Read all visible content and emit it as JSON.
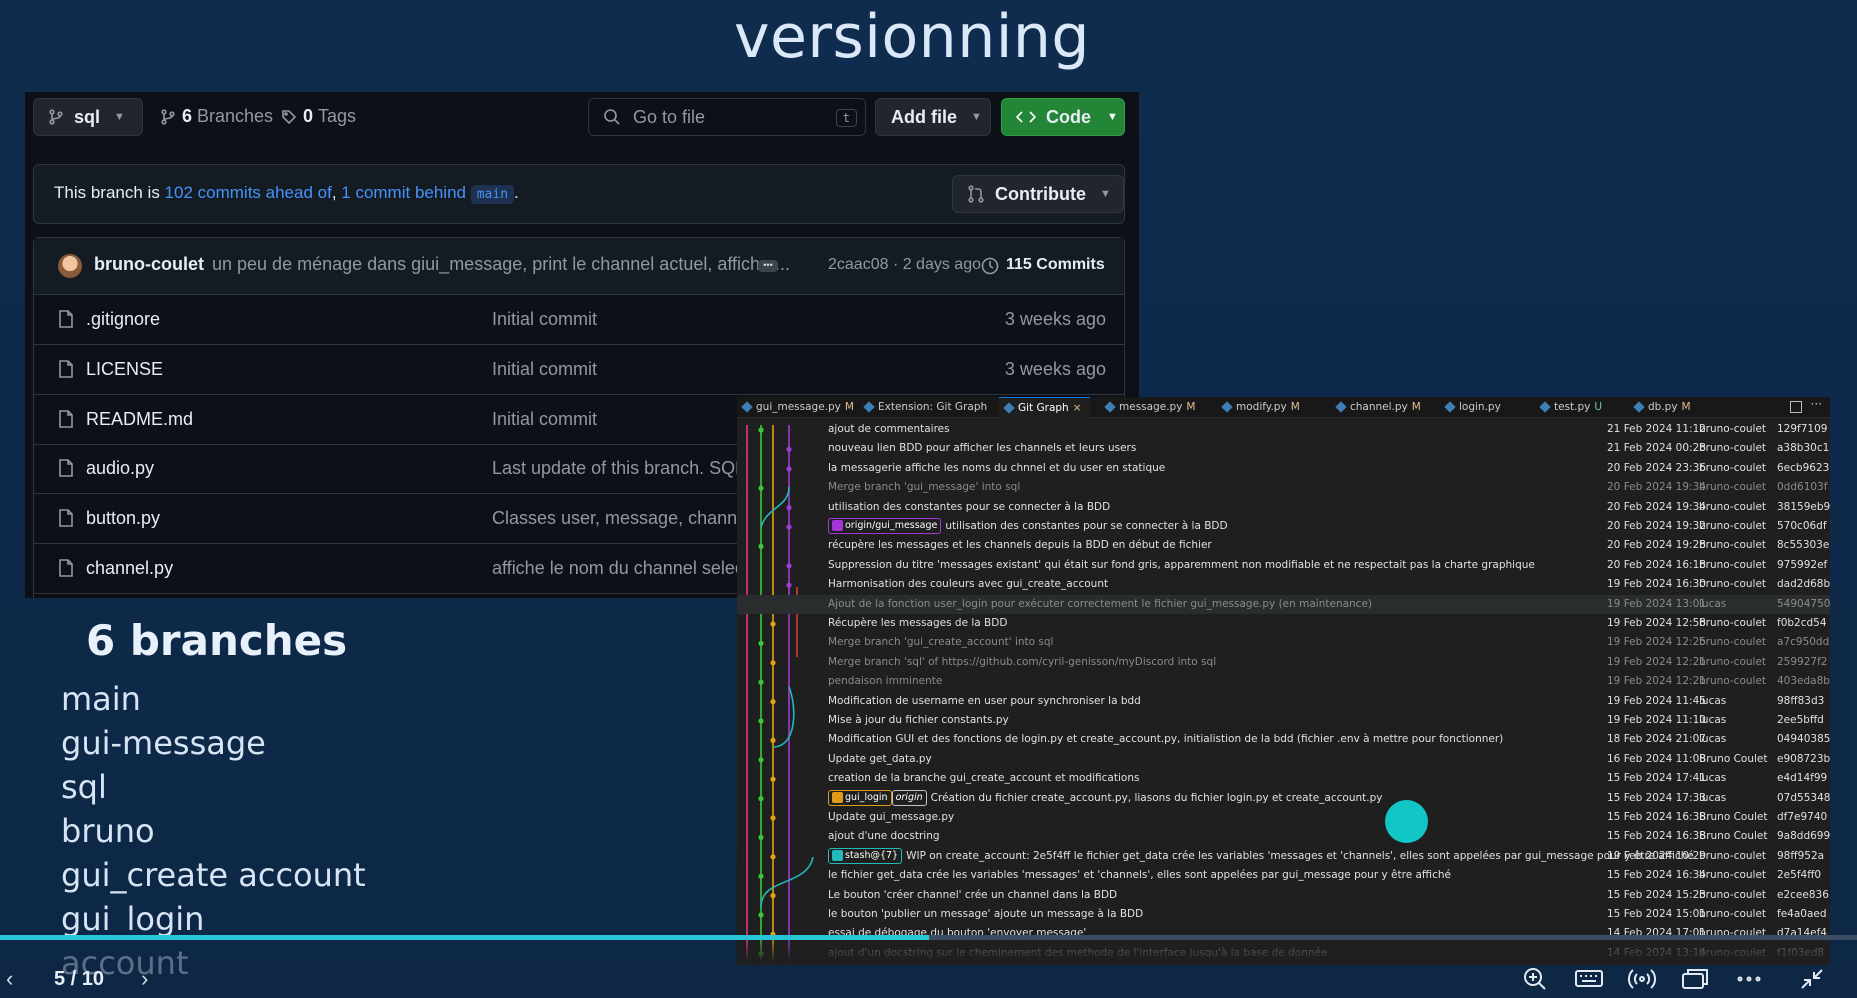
{
  "slide": {
    "title": "versionning",
    "branches_title": "6 branches",
    "branches": [
      "main",
      "gui-message",
      "sql",
      "bruno",
      "gui_create account",
      "gui_login",
      "account"
    ],
    "pager": "5 / 10",
    "progress": 0.5
  },
  "github": {
    "branch_selector": "sql",
    "branches_count": "6",
    "branches_label": "Branches",
    "tags_count": "0",
    "tags_label": "Tags",
    "search_placeholder": "Go to file",
    "search_shortcut": "t",
    "add_file_label": "Add file",
    "code_label": "Code",
    "banner": {
      "prefix": "This branch is ",
      "ahead_link": "102 commits ahead of",
      "separator": ", ",
      "behind_link": "1 commit behind",
      "space": " ",
      "base_branch": "main",
      "suffix": "."
    },
    "contribute_label": "Contribute",
    "last_commit": {
      "author": "bruno-coulet",
      "message": "un peu de ménage dans giui_message, print le channel actuel, affiche ...",
      "hash_time": "2caac08 · 2 days ago",
      "commits_count": "115 Commits"
    },
    "files": [
      {
        "name": ".gitignore",
        "message": "Initial commit",
        "date": "3 weeks ago"
      },
      {
        "name": "LICENSE",
        "message": "Initial commit",
        "date": "3 weeks ago"
      },
      {
        "name": "README.md",
        "message": "Initial commit",
        "date": ""
      },
      {
        "name": "audio.py",
        "message": "Last update of this branch. SQL o",
        "date": ""
      },
      {
        "name": "button.py",
        "message": "Classes user, message, channel, D",
        "date": ""
      },
      {
        "name": "channel.py",
        "message": "affiche le nom du channel selecti",
        "date": ""
      }
    ]
  },
  "vscode": {
    "tabs": [
      {
        "label": "gui_message.py",
        "status": "M",
        "icon": "python-file-icon"
      },
      {
        "label": "Extension: Git Graph",
        "status": "",
        "icon": "extension-icon"
      },
      {
        "label": "Git Graph",
        "status": "×",
        "icon": "git-graph-icon"
      },
      {
        "label": "message.py",
        "status": "M",
        "icon": "python-file-icon"
      },
      {
        "label": "modify.py",
        "status": "M",
        "icon": "python-file-icon"
      },
      {
        "label": "channel.py",
        "status": "M",
        "icon": "python-file-icon"
      },
      {
        "label": "login.py",
        "status": "",
        "icon": "python-file-icon"
      },
      {
        "label": "test.py",
        "status": "U",
        "icon": "python-file-icon"
      },
      {
        "label": "db.py",
        "status": "M",
        "icon": "python-file-icon"
      }
    ],
    "more": "···",
    "commits": [
      {
        "message": "ajout de commentaires",
        "date": "21 Feb 2024 11:12",
        "author": "bruno-coulet",
        "hash": "129f7109"
      },
      {
        "message": "nouveau lien BDD pour afficher les channels et leurs users",
        "date": "21 Feb 2024 00:28",
        "author": "bruno-coulet",
        "hash": "a38b30c1"
      },
      {
        "message": "la messagerie affiche les noms du chnnel et du user en statique",
        "date": "20 Feb 2024 23:36",
        "author": "bruno-coulet",
        "hash": "6ecb9623"
      },
      {
        "message": "Merge branch 'gui_message' into sql",
        "date": "20 Feb 2024 19:34",
        "author": "bruno-coulet",
        "hash": "0dd6103f",
        "dim": true
      },
      {
        "message": "utilisation des constantes pour se connecter à la BDD",
        "date": "20 Feb 2024 19:34",
        "author": "bruno-coulet",
        "hash": "38159eb9"
      },
      {
        "ref": "origin/gui_message",
        "message": "utilisation des constantes pour se connecter à la BDD",
        "date": "20 Feb 2024 19:32",
        "author": "bruno-coulet",
        "hash": "570c06df"
      },
      {
        "message": "récupère les messages et les channels depuis la BDD en début de fichier",
        "date": "20 Feb 2024 19:28",
        "author": "bruno-coulet",
        "hash": "8c55303e"
      },
      {
        "message": "Suppression du titre 'messages existant' qui était sur fond gris, apparemment non modifiable et ne respectait pas la charte graphique",
        "date": "20 Feb 2024 16:18",
        "author": "bruno-coulet",
        "hash": "975992ef"
      },
      {
        "message": "Harmonisation des couleurs avec gui_create_account",
        "date": "19 Feb 2024 16:30",
        "author": "bruno-coulet",
        "hash": "dad2d68b"
      },
      {
        "message": "Ajout de la fonction user_login pour exécuter correctement le fichier gui_message.py (en maintenance)",
        "date": "19 Feb 2024 13:01",
        "author": "lucas",
        "hash": "54904750",
        "dim": true,
        "hl": true
      },
      {
        "message": "Récupère les messages de la BDD",
        "date": "19 Feb 2024 12:58",
        "author": "bruno-coulet",
        "hash": "f0b2cd54"
      },
      {
        "message": "Merge branch 'gui_create_account' into sql",
        "date": "19 Feb 2024 12:25",
        "author": "bruno-coulet",
        "hash": "a7c950dd",
        "dim": true
      },
      {
        "message": "Merge branch 'sql' of https://github.com/cyril-genisson/myDiscord into sql",
        "date": "19 Feb 2024 12:21",
        "author": "bruno-coulet",
        "hash": "259927f2",
        "dim": true
      },
      {
        "message": "pendaison imminente",
        "date": "19 Feb 2024 12:21",
        "author": "bruno-coulet",
        "hash": "403eda8b",
        "dim": true
      },
      {
        "message": "Modification de username en user pour synchroniser la bdd",
        "date": "19 Feb 2024 11:45",
        "author": "lucas",
        "hash": "98ff83d3"
      },
      {
        "message": "Mise à jour du fichier constants.py",
        "date": "19 Feb 2024 11:10",
        "author": "lucas",
        "hash": "2ee5bffd"
      },
      {
        "message": "Modification GUI et des fonctions de login.py et create_account.py, initialistion de la bdd (fichier .env à mettre pour fonctionner)",
        "date": "18 Feb 2024 21:07",
        "author": "lucas",
        "hash": "04940385"
      },
      {
        "message": "Update get_data.py",
        "date": "16 Feb 2024 11:08",
        "author": "Bruno Coulet",
        "hash": "e908723b"
      },
      {
        "message": "creation de la branche gui_create_account et modifications",
        "date": "15 Feb 2024 17:41",
        "author": "lucas",
        "hash": "e4d14f99"
      },
      {
        "ref": "gui_login",
        "ref2": "origin",
        "message": "Création du fichier create_account.py, liasons du fichier login.py et create_account.py",
        "date": "15 Feb 2024 17:33",
        "author": "lucas",
        "hash": "07d55348"
      },
      {
        "message": "Update gui_message.py",
        "date": "15 Feb 2024 16:38",
        "author": "Bruno Coulet",
        "hash": "df7e9740"
      },
      {
        "message": "ajout d'une docstring",
        "date": "15 Feb 2024 16:38",
        "author": "Bruno Coulet",
        "hash": "9a8dd699"
      },
      {
        "ref": "stash@{7}",
        "message": "WIP on create_account: 2e5f4ff le fichier get_data crée les variables 'messages et 'channels', elles sont appelées par gui_message pour y être affiché",
        "date": "19 Feb 2024 10:29",
        "author": "bruno-coulet",
        "hash": "98ff952a"
      },
      {
        "message": "le fichier get_data crée les variables 'messages' et 'channels', elles sont appelées par gui_message pour y être affiché",
        "date": "15 Feb 2024 16:34",
        "author": "bruno-coulet",
        "hash": "2e5f4ff0"
      },
      {
        "message": "Le bouton 'créer channel' crée un channel dans la BDD",
        "date": "15 Feb 2024 15:23",
        "author": "bruno-coulet",
        "hash": "e2cee836"
      },
      {
        "message": "le bouton 'publier un message' ajoute un message à la BDD",
        "date": "15 Feb 2024 15:01",
        "author": "bruno-coulet",
        "hash": "fe4a0aed"
      },
      {
        "message": "essai de débogage du bouton 'envoyer message'",
        "date": "14 Feb 2024 17:01",
        "author": "bruno-coulet",
        "hash": "d7a14ef4"
      },
      {
        "message": "ajout d'un docstring sur le cheminement des methode de l'interface jusqu'à la base de donnée",
        "date": "14 Feb 2024 13:14",
        "author": "bruno-coulet",
        "hash": "f1f03ed8",
        "dim": true
      }
    ]
  },
  "colors": {
    "slide_bg": "#0e2a4a",
    "accent": "#27c5d6",
    "github_green": "#238636",
    "github_link": "#4493f8"
  }
}
